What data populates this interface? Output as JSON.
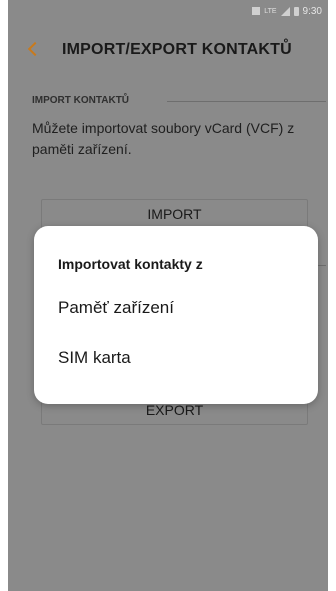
{
  "status_bar": {
    "lte_label": "LTE",
    "time": "9:30"
  },
  "header": {
    "title": "IMPORT/EXPORT KONTAKTŮ"
  },
  "import_section": {
    "header": "IMPORT KONTAKTŮ",
    "description": "Můžete importovat soubory vCard (VCF) z paměti zařízení.",
    "button_label": "IMPORT"
  },
  "export_section": {
    "button_label": "EXPORT"
  },
  "dialog": {
    "title": "Importovat kontakty z",
    "options": [
      {
        "label": "Paměť zařízení"
      },
      {
        "label": "SIM karta"
      }
    ]
  },
  "colors": {
    "accent": "#c97a1c",
    "dim_overlay_bg": "#8a8a8a",
    "dialog_bg": "#ffffff"
  }
}
